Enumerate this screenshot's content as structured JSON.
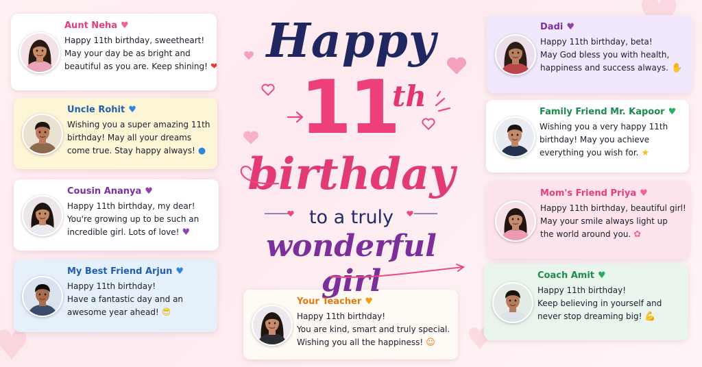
{
  "title": {
    "happy": "Happy",
    "number": "11",
    "suffix": "th",
    "birthday": "birthday",
    "to_a_truly": "to a truly",
    "wonderful_girl": "wonderful girl"
  },
  "colors": {
    "navy": "#1f2660",
    "pink": "#e23a77",
    "purple": "#7a2f9b"
  },
  "cards": [
    {
      "id": "aunt-neha",
      "name": "Aunt Neha",
      "name_color": "#e43e7f",
      "badge": "♥",
      "badge_color": "#f06292",
      "bg": "#ffffff",
      "lines": [
        "Happy 11th birthday, sweetheart!",
        "May your day be as bright and",
        "beautiful as you are. Keep shining!"
      ],
      "emoji": "❤",
      "emoji_color": "#e53935",
      "avatar": {
        "skin": "#c98a6a",
        "hair": "#2a1a14",
        "shirt": "#e8a4b8",
        "bg": "#f4e2e6",
        "long_hair": true
      }
    },
    {
      "id": "uncle-rohit",
      "name": "Uncle Rohit",
      "name_color": "#1f5fae",
      "badge": "♥",
      "badge_color": "#2e86de",
      "bg": "#fdf6d6",
      "lines": [
        "Wishing you a super amazing 11th",
        "birthday! May all your dreams",
        "come true. Stay happy always!"
      ],
      "emoji": "●",
      "emoji_color": "#2e86de",
      "avatar": {
        "skin": "#b87a58",
        "hair": "#1e140f",
        "shirt": "#8b6a4d",
        "bg": "#e9e1d2",
        "long_hair": false
      }
    },
    {
      "id": "cousin-ananya",
      "name": "Cousin Ananya",
      "name_color": "#7b2fa0",
      "badge": "♥",
      "badge_color": "#8e44ad",
      "bg": "#ffffff",
      "lines": [
        "Happy 11th birthday, my dear!",
        "You're growing up to be such an",
        "incredible girl. Lots of love!"
      ],
      "emoji": "♥",
      "emoji_color": "#8e44ad",
      "avatar": {
        "skin": "#c38866",
        "hair": "#1f130e",
        "shirt": "#e9e9f0",
        "bg": "#ece6ea",
        "long_hair": true
      }
    },
    {
      "id": "best-friend-arjun",
      "name": "My Best Friend Arjun",
      "name_color": "#1f5fae",
      "badge": "♥",
      "badge_color": "#2e86de",
      "bg": "#e6f0fb",
      "lines": [
        "Happy 11th birthday!",
        "Have a fantastic day and an",
        "awesome year ahead!"
      ],
      "emoji": "😎",
      "emoji_color": "#f5b300",
      "avatar": {
        "skin": "#a86f4f",
        "hair": "#120c09",
        "shirt": "#3a4b6e",
        "bg": "#d9e3ee",
        "long_hair": false
      }
    },
    {
      "id": "your-teacher",
      "name": "Your Teacher",
      "name_color": "#e07b12",
      "badge": "♥",
      "badge_color": "#f39c12",
      "bg": "#fffaf4",
      "lines": [
        "Happy 11th birthday!",
        "You are kind, smart and truly special.",
        "Wishing you all the happiness!"
      ],
      "emoji": "☺",
      "emoji_color": "#e67e22",
      "avatar": {
        "skin": "#c48b6c",
        "hair": "#21150f",
        "shirt": "#2b2b33",
        "bg": "#ece9ee",
        "long_hair": true
      }
    },
    {
      "id": "dadi",
      "name": "Dadi",
      "name_color": "#7b2fa0",
      "badge": "♥",
      "badge_color": "#8e44ad",
      "bg": "#f1e9fb",
      "lines": [
        "Happy 11th birthday, beta!",
        "May God bless you with health,",
        "happiness and success always."
      ],
      "emoji": "✋",
      "emoji_color": "#f0a33a",
      "avatar": {
        "skin": "#b9805e",
        "hair": "#2b1d16",
        "shirt": "#b8454a",
        "bg": "#eadfe8",
        "long_hair": true
      }
    },
    {
      "id": "family-friend-kapoor",
      "name": "Family Friend Mr. Kapoor",
      "name_color": "#1e8a4c",
      "badge": "♥",
      "badge_color": "#27ae60",
      "bg": "#ffffff",
      "lines": [
        "Wishing you a very happy 11th",
        "birthday! May you achieve",
        "everything you wish for."
      ],
      "emoji": "★",
      "emoji_color": "#f1c40f",
      "avatar": {
        "skin": "#c08a68",
        "hair": "#1b1310",
        "shirt": "#24324f",
        "bg": "#e8ecf2",
        "long_hair": false
      }
    },
    {
      "id": "moms-friend-priya",
      "name": "Mom's Friend Priya",
      "name_color": "#e43e7f",
      "badge": "♥",
      "badge_color": "#f06292",
      "bg": "#fde4ec",
      "lines": [
        "Happy 11th birthday, beautiful girl!",
        "May your smile always light up",
        "the world around you."
      ],
      "emoji": "✿",
      "emoji_color": "#f06292",
      "avatar": {
        "skin": "#c48c6c",
        "hair": "#22150f",
        "shirt": "#ef9ab5",
        "bg": "#f6e3ea",
        "long_hair": true
      }
    },
    {
      "id": "coach-amit",
      "name": "Coach Amit",
      "name_color": "#1e8a4c",
      "badge": "♥",
      "badge_color": "#27ae60",
      "bg": "#e9f5ec",
      "lines": [
        "Happy 11th birthday!",
        "Keep believing in yourself and",
        "never stop dreaming big!"
      ],
      "emoji": "💪",
      "emoji_color": "#f0a33a",
      "avatar": {
        "skin": "#b57c5b",
        "hair": "#1a120e",
        "shirt": "#dde2ea",
        "bg": "#e4ebe6",
        "long_hair": false
      }
    }
  ]
}
